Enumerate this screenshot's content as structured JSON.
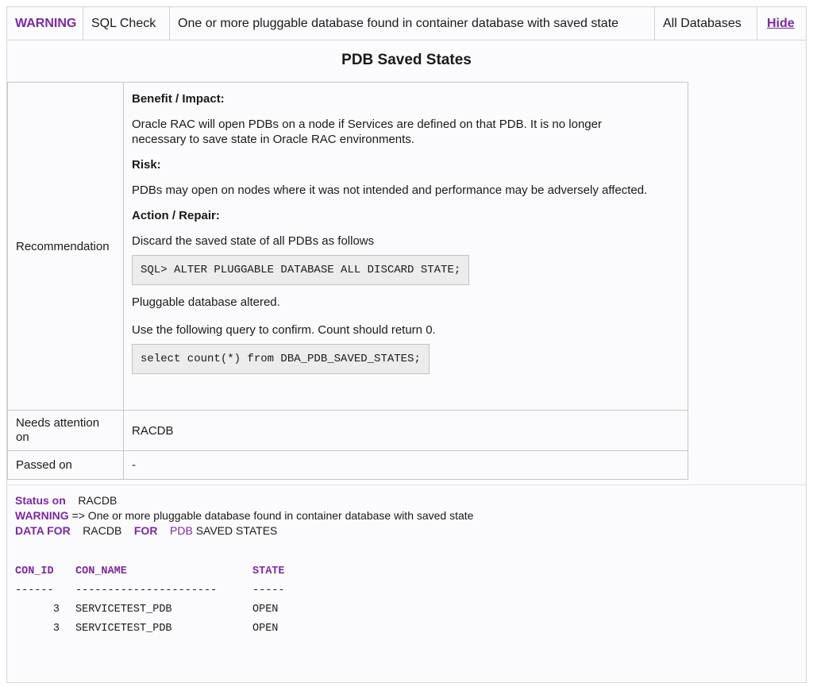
{
  "header": {
    "severity": "WARNING",
    "check_type": "SQL Check",
    "message": "One or more pluggable database found in container database with saved state",
    "scope": "All Databases",
    "hide_link": "Hide"
  },
  "title": "PDB Saved States",
  "recommendation": {
    "label": "Recommendation",
    "benefit_heading": "Benefit / Impact:",
    "benefit_text": "Oracle RAC will open PDBs on a node if Services are defined on that PDB. It is no longer necessary to save state in Oracle RAC environments.",
    "risk_heading": "Risk:",
    "risk_text": "PDBs may open on nodes where it was not intended and performance may be adversely affected.",
    "action_heading": "Action / Repair:",
    "action_text": "Discard the saved state of all PDBs as follows",
    "action_code": "SQL> ALTER PLUGGABLE DATABASE ALL DISCARD STATE;",
    "action_result": "Pluggable database altered.",
    "confirm_text": "Use the following query to confirm.  Count should return 0.",
    "confirm_code": "select count(*) from DBA_PDB_SAVED_STATES;"
  },
  "needs_attention": {
    "label": "Needs attention on",
    "value": "RACDB"
  },
  "passed_on": {
    "label": "Passed on",
    "value": "-"
  },
  "status": {
    "status_label": "Status on",
    "status_value": "RACDB",
    "warning_label": "WARNING",
    "warning_text": "=> One or more pluggable database found in container database with saved state",
    "data_for_label": "DATA FOR",
    "data_for_db": "RACDB",
    "for_label": "FOR",
    "pdb_label": "PDB",
    "saved_states": "SAVED STATES"
  },
  "results": {
    "columns": [
      "CON_ID",
      "CON_NAME",
      "STATE"
    ],
    "separators": [
      "------",
      "----------------------",
      "-----"
    ],
    "rows": [
      [
        "3",
        "SERVICETEST_PDB",
        "OPEN"
      ],
      [
        "3",
        "SERVICETEST_PDB",
        "OPEN"
      ]
    ]
  },
  "colors": {
    "accent": "#7b2a9c",
    "code_bg": "#ececec",
    "border": "#c7c7c7"
  }
}
